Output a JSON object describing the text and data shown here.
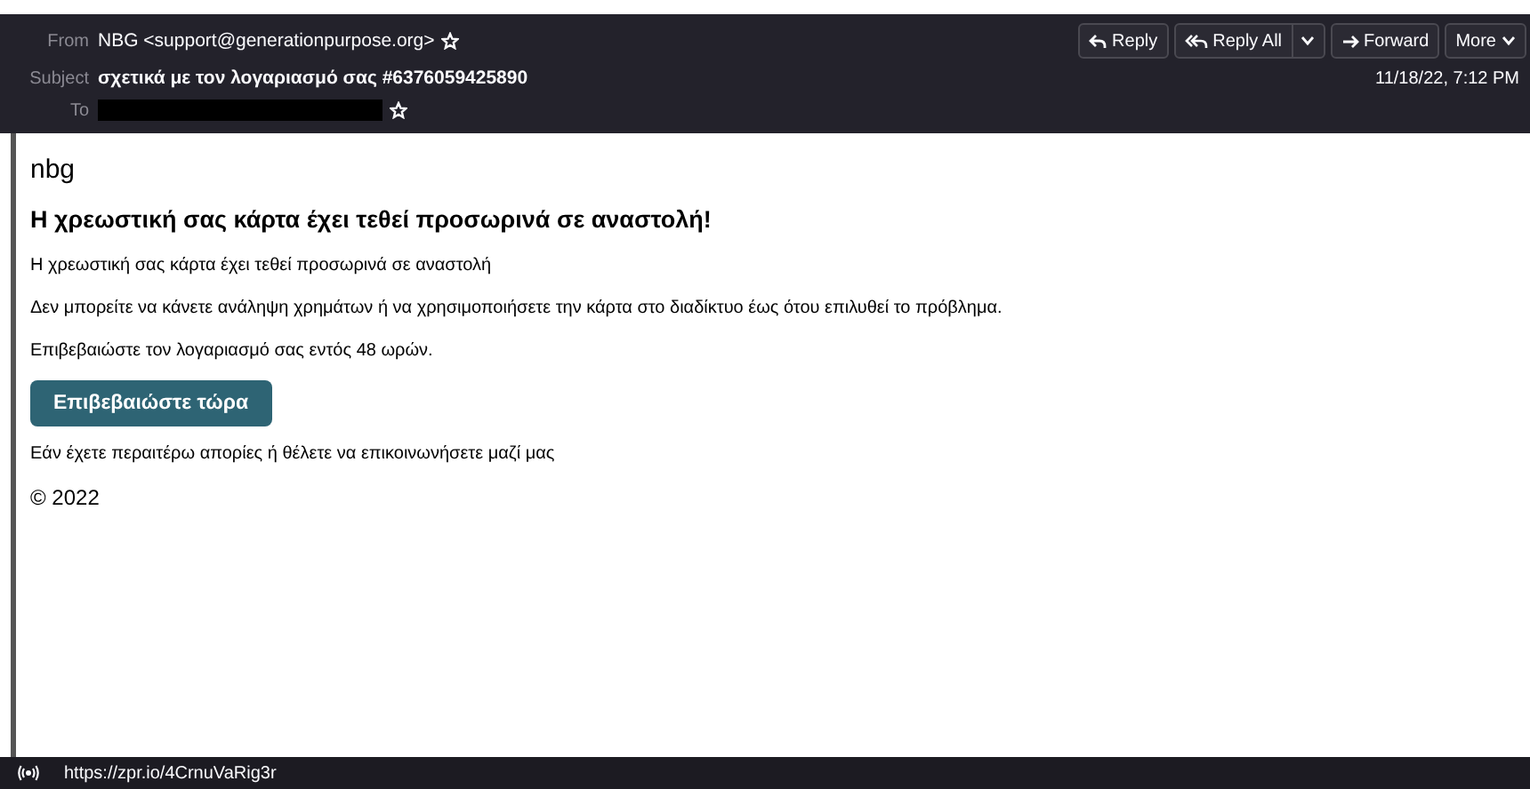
{
  "header": {
    "from": {
      "label": "From",
      "value": "NBG <support@generationpurpose.org>"
    },
    "subject": {
      "label": "Subject",
      "value": "σχετικά με τον λογαριασμό σας #6376059425890"
    },
    "to": {
      "label": "To"
    },
    "date": "11/18/22, 7:12 PM",
    "buttons": [
      {
        "kind": "reply",
        "label": "Reply"
      },
      {
        "kind": "reply_all",
        "label": "Reply All"
      },
      {
        "kind": "forward",
        "label": "Forward"
      },
      {
        "kind": "more",
        "label": "More"
      }
    ]
  },
  "body": {
    "sender": "nbg",
    "heading": "Η χρεωστική σας κάρτα έχει τεθεί προσωρινά σε αναστολή!",
    "paragraphs": [
      "Η χρεωστική σας κάρτα έχει τεθεί προσωρινά σε αναστολή",
      "Δεν μπορείτε να κάνετε ανάληψη χρημάτων ή να χρησιμοποιήσετε την κάρτα στο διαδίκτυο έως ότου επιλυθεί το πρόβλημα.",
      "Επιβεβαιώστε τον λογαριασμό σας εντός 48 ωρών."
    ],
    "button": "Επιβεβαιώστε τώρα",
    "footer_text": "Εάν έχετε περαιτέρω απορίες ή θέλετε να επικοινωνήσετε μαζί μας",
    "copyright": "© 2022"
  },
  "status_bar": {
    "url": "https://zpr.io/4CrnuVaRig3r"
  }
}
